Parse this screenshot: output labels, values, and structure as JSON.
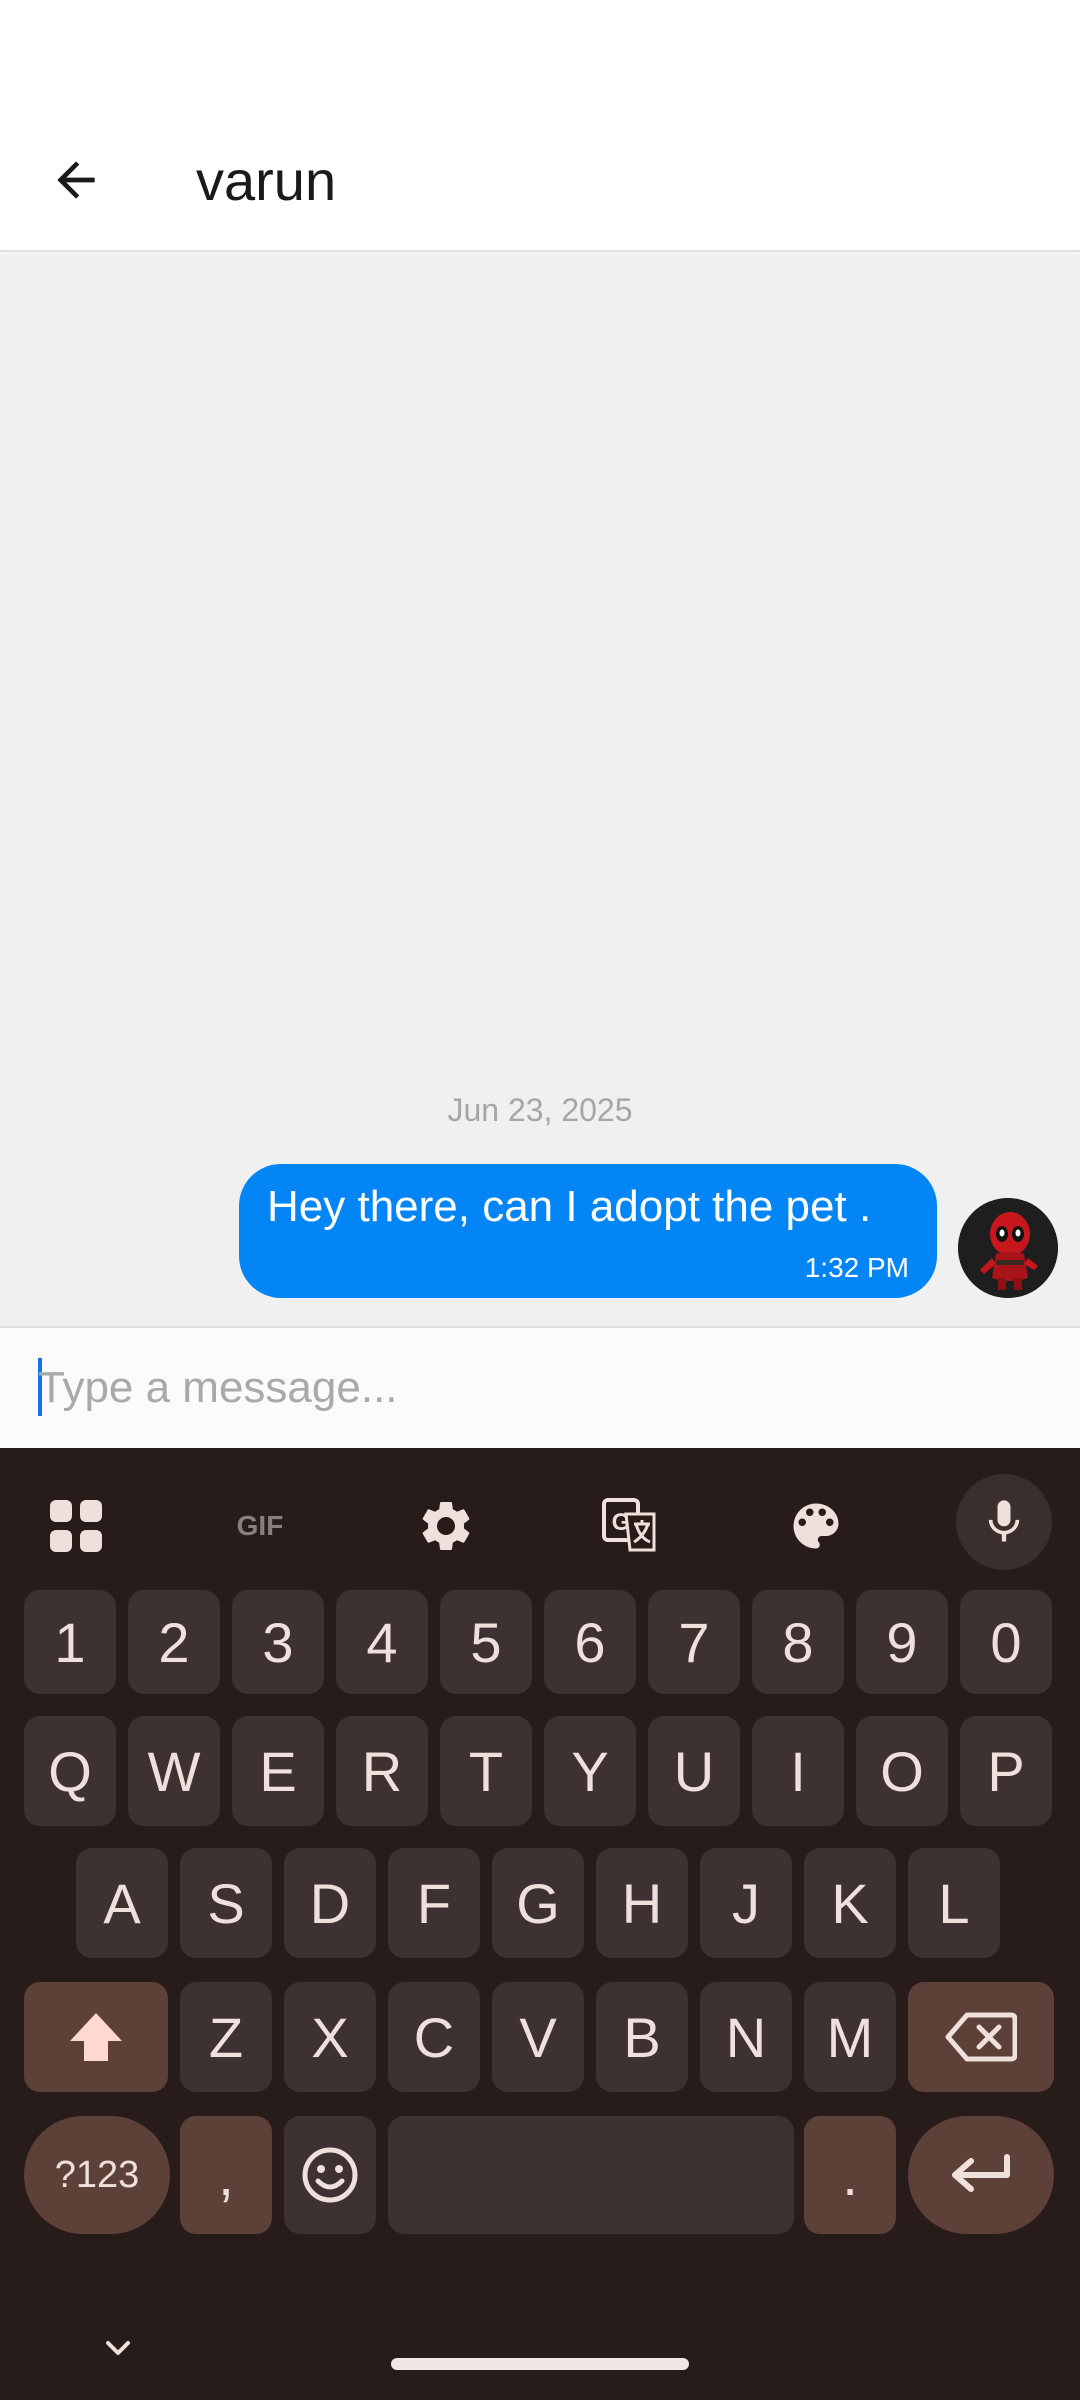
{
  "header": {
    "title": "varun"
  },
  "chat": {
    "date_separator": "Jun 23, 2025",
    "messages": [
      {
        "text": "Hey there, can I adopt the pet .",
        "time": "1:32 PM",
        "direction": "outgoing"
      }
    ]
  },
  "composer": {
    "placeholder": "Type a message...",
    "value": ""
  },
  "keyboard": {
    "toolbar": {
      "icons": [
        "apps-grid-icon",
        "gif-icon",
        "settings-gear-icon",
        "translate-icon",
        "palette-icon",
        "microphone-icon"
      ],
      "gif_label": "GIF"
    },
    "number_row": [
      "1",
      "2",
      "3",
      "4",
      "5",
      "6",
      "7",
      "8",
      "9",
      "0"
    ],
    "row1": [
      "Q",
      "W",
      "E",
      "R",
      "T",
      "Y",
      "U",
      "I",
      "O",
      "P"
    ],
    "row2": [
      "A",
      "S",
      "D",
      "F",
      "G",
      "H",
      "J",
      "K",
      "L"
    ],
    "row3": [
      "Z",
      "X",
      "C",
      "V",
      "B",
      "N",
      "M"
    ],
    "symbols_label": "?123",
    "comma": ",",
    "period": "."
  },
  "colors": {
    "bubble": "#0485f5",
    "chat_background": "#f0f0f0",
    "keyboard_background": "#271c1a",
    "key": "#3d3231",
    "function_key": "#5d4038",
    "key_text": "#efe0dc",
    "caret": "#1a73e8"
  }
}
